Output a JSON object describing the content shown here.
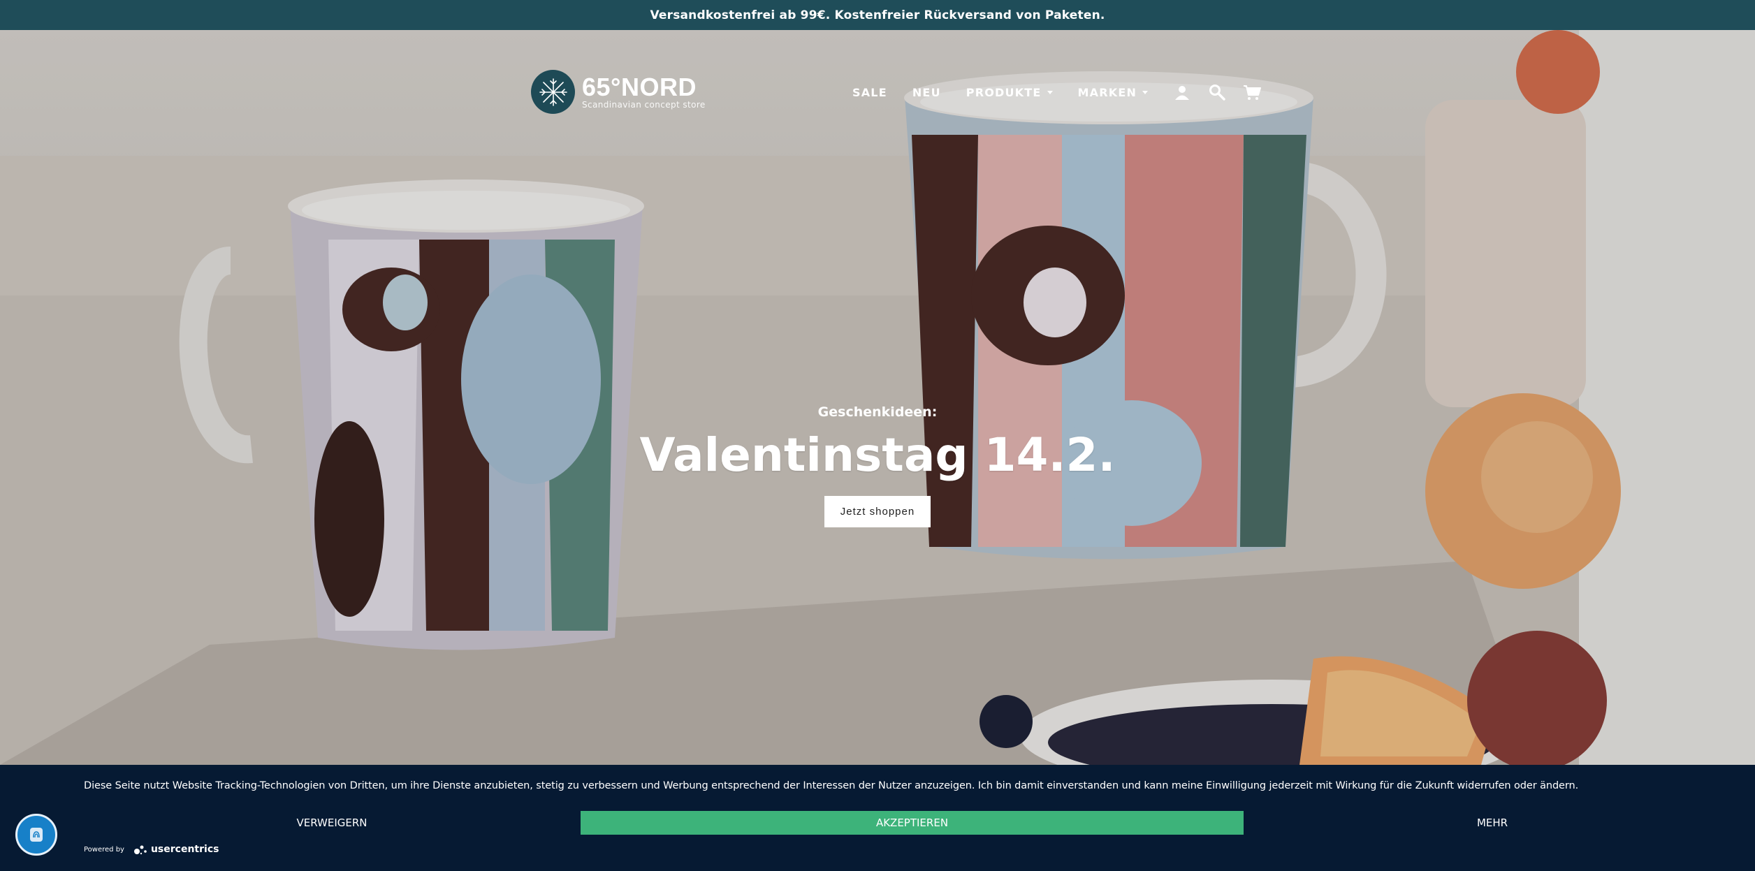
{
  "announcement": {
    "text": "Versandkostenfrei ab 99€. Kostenfreier Rückversand von Paketen."
  },
  "header": {
    "logo_name": "65°NORD",
    "logo_tagline": "Scandinavian concept store",
    "nav": [
      {
        "label": "SALE"
      },
      {
        "label": "NEU"
      },
      {
        "label": "PRODUKTE",
        "has_dropdown": true
      },
      {
        "label": "MARKEN",
        "has_dropdown": true
      }
    ],
    "icons": [
      "account-icon",
      "search-icon",
      "cart-icon"
    ]
  },
  "hero": {
    "subtitle": "Geschenkideen:",
    "title": "Valentinstag 14.2.",
    "cta_label": "Jetzt shoppen"
  },
  "cookie_banner": {
    "text": "Diese Seite nutzt Website Tracking-Technologien von Dritten, um ihre Dienste anzubieten, stetig zu verbessern und Werbung entsprechend der Interessen der Nutzer anzuzeigen. Ich bin damit einverstanden und kann meine Einwilligung jederzeit mit Wirkung für die Zukunft widerrufen oder ändern.",
    "deny_label": "VERWEIGERN",
    "accept_label": "AKZEPTIEREN",
    "more_label": "MEHR",
    "powered_by": "Powered by",
    "brand": "usercentrics"
  },
  "colors": {
    "announcement_bg": "#1f4d59",
    "cookie_bg": "#061a33",
    "accept_bg": "#3db37a",
    "privacy_fab": "#1780c8"
  }
}
